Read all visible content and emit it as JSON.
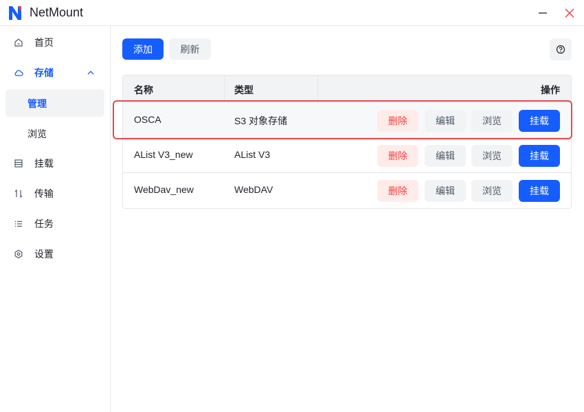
{
  "app": {
    "title": "NetMount",
    "brand_color": "#165dff"
  },
  "window": {
    "minimize_icon": "minimize-icon",
    "close_icon": "close-icon"
  },
  "sidebar": {
    "items": [
      {
        "label": "首页",
        "icon": "home-icon"
      },
      {
        "label": "存储",
        "icon": "cloud-icon",
        "expanded": true
      },
      {
        "label": "管理",
        "sub": true,
        "selected": true
      },
      {
        "label": "浏览",
        "sub": true
      },
      {
        "label": "挂载",
        "icon": "storage-icon"
      },
      {
        "label": "传输",
        "icon": "transfer-icon"
      },
      {
        "label": "任务",
        "icon": "list-icon"
      },
      {
        "label": "设置",
        "icon": "gear-icon"
      }
    ]
  },
  "toolbar": {
    "add_label": "添加",
    "refresh_label": "刷新",
    "help_icon": "help-icon"
  },
  "table": {
    "headers": [
      "名称",
      "类型",
      "操作"
    ],
    "rows": [
      {
        "name": "OSCA",
        "type": "S3 对象存储",
        "highlighted": true
      },
      {
        "name": "AList V3_new",
        "type": "AList V3"
      },
      {
        "name": "WebDav_new",
        "type": "WebDAV"
      }
    ],
    "actions": {
      "delete": "删除",
      "edit": "编辑",
      "browse": "浏览",
      "mount": "挂载"
    }
  },
  "colors": {
    "primary": "#165dff",
    "danger": "#f53f3f",
    "danger_bg": "#ffece8",
    "highlight_border": "#e5484d"
  }
}
